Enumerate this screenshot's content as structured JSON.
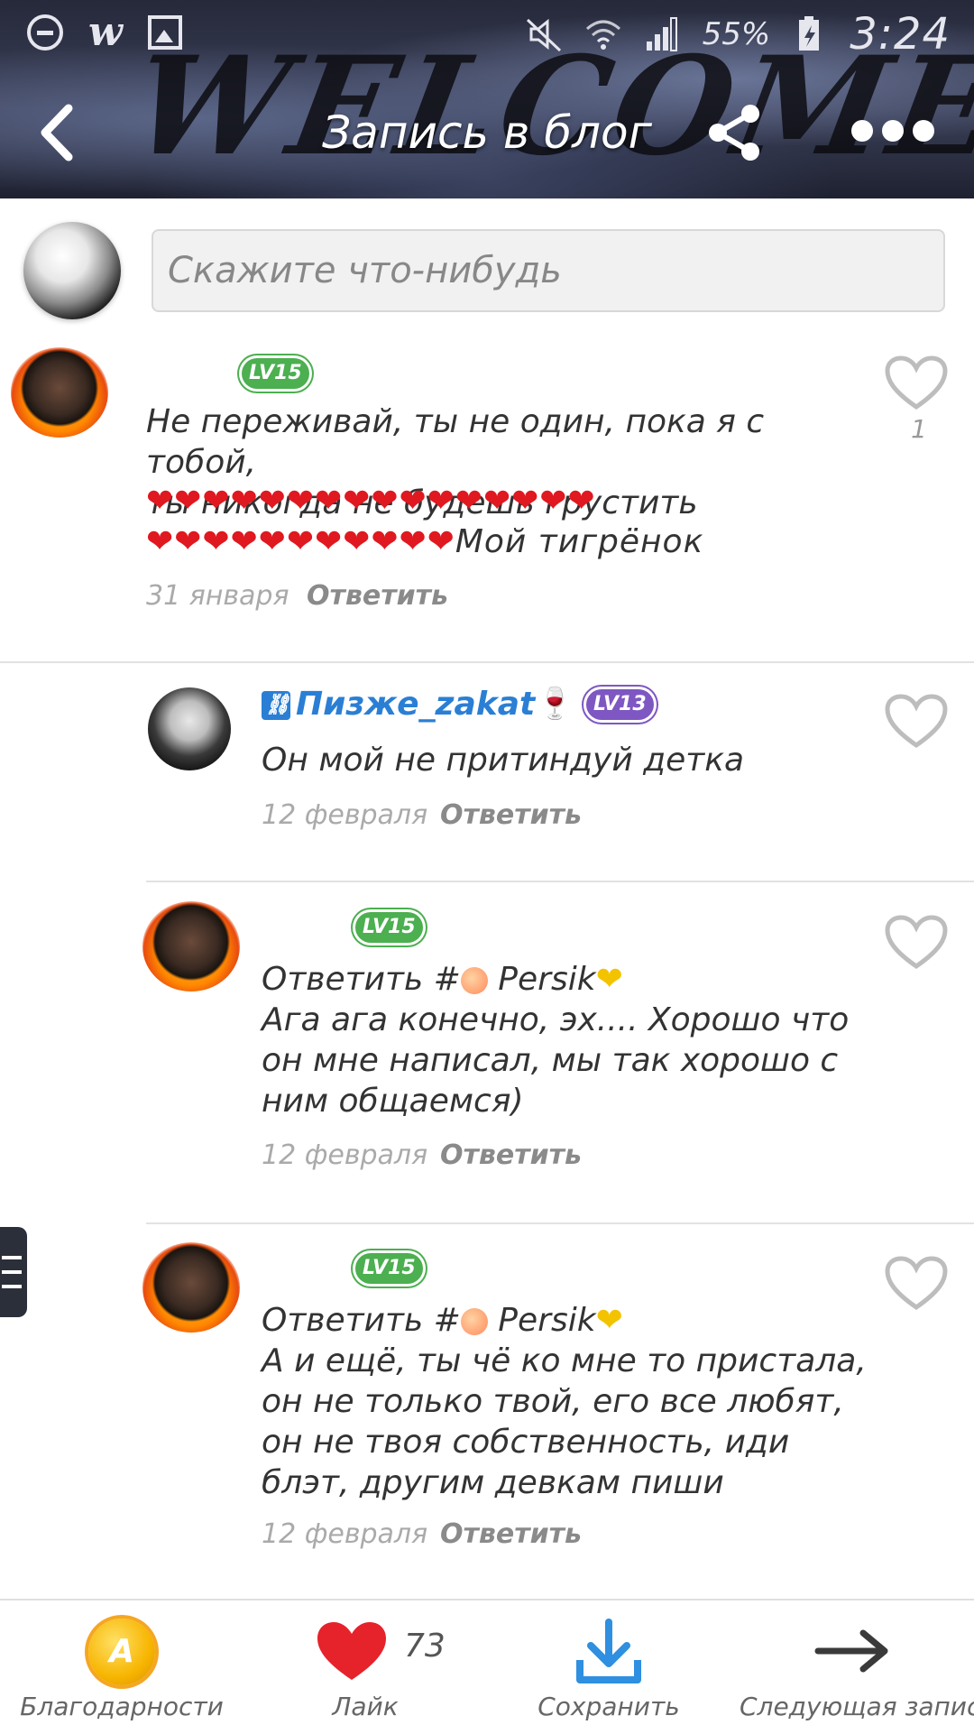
{
  "status_bar": {
    "battery_percent": "55%",
    "time": "3:24"
  },
  "header": {
    "banner_text": "WELCOME",
    "title": "Запись в блог"
  },
  "composer": {
    "placeholder": "Скажите что-нибудь"
  },
  "comments": [
    {
      "level": "LV15",
      "text": "Не переживай, ты не один, пока я с тобой,\nты никогда не будешь грустить",
      "hearts_line1": "❤❤❤❤❤❤❤❤❤❤❤❤❤❤❤❤",
      "hearts_line2": "❤❤❤❤❤❤❤❤❤❤❤",
      "tail": "Мой тигрёнок",
      "likes": "1",
      "date": "31 января",
      "reply": "Ответить"
    },
    {
      "name": "Пизже_zakat",
      "name_emoji": "🍷",
      "level": "LV13",
      "text": "Он мой не притиндуй детка",
      "date": "12 февраля",
      "reply": "Ответить"
    },
    {
      "level": "LV15",
      "reply_prefix": "Ответить #",
      "reply_to": "Persik",
      "text": "Ага ага конечно, эх.... Хорошо что\nон мне написал, мы так хорошо с\nним общаемся)",
      "date": "12 февраля",
      "reply": "Ответить"
    },
    {
      "level": "LV15",
      "reply_prefix": "Ответить #",
      "reply_to": "Persik",
      "text": "А и ещё, ты чё ко мне то пристала,\nон не только твой, его все любят,\nон не твоя собственность, иди\nблэт, другим девкам пиши",
      "date": "12 февраля",
      "reply": "Ответить"
    }
  ],
  "bottom_bar": {
    "thanks_label": "Благодарности",
    "like_label": "Лайк",
    "like_count": "73",
    "save_label": "Сохранить",
    "next_label": "Следующая запись"
  },
  "colors": {
    "accent_blue": "#2a7fd4",
    "heart_red": "#e0181f",
    "level_green": "#4caf50",
    "level_purple": "#7e57c2",
    "coin_gold": "#f7b500"
  }
}
